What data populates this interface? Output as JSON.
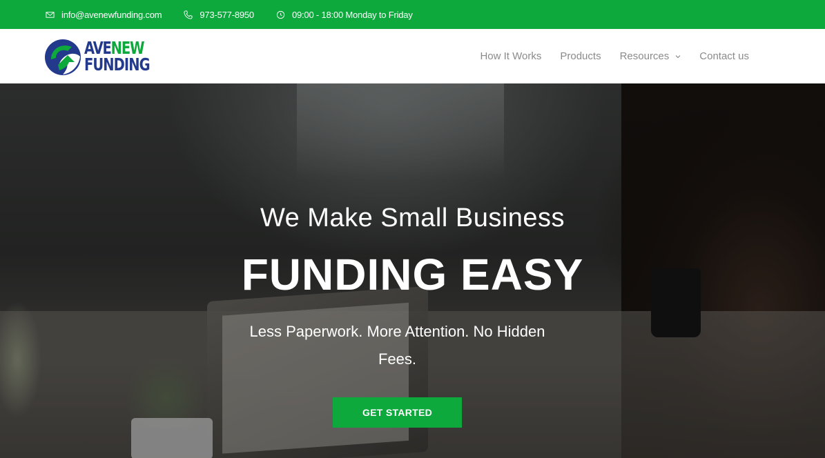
{
  "topbar": {
    "email": "info@avenewfunding.com",
    "phone": "973-577-8950",
    "hours": "09:00 - 18:00 Monday to Friday",
    "icons": [
      "envelope-icon",
      "phone-icon",
      "clock-icon"
    ]
  },
  "logo": {
    "line1_a": "AVE",
    "line1_b": "NEW",
    "line2": "FUNDING"
  },
  "nav": {
    "items": [
      {
        "label": "How It Works"
      },
      {
        "label": "Products"
      },
      {
        "label": "Resources",
        "has_dropdown": true
      },
      {
        "label": "Contact us"
      }
    ]
  },
  "hero": {
    "subtitle": "We Make Small Business",
    "title": "FUNDING EASY",
    "tagline": "Less Paperwork. More Attention. No Hidden Fees.",
    "cta_label": "GET STARTED"
  },
  "colors": {
    "brand_green": "#0ea93d",
    "brand_blue": "#233a8c",
    "nav_text": "#8a8a8a"
  }
}
